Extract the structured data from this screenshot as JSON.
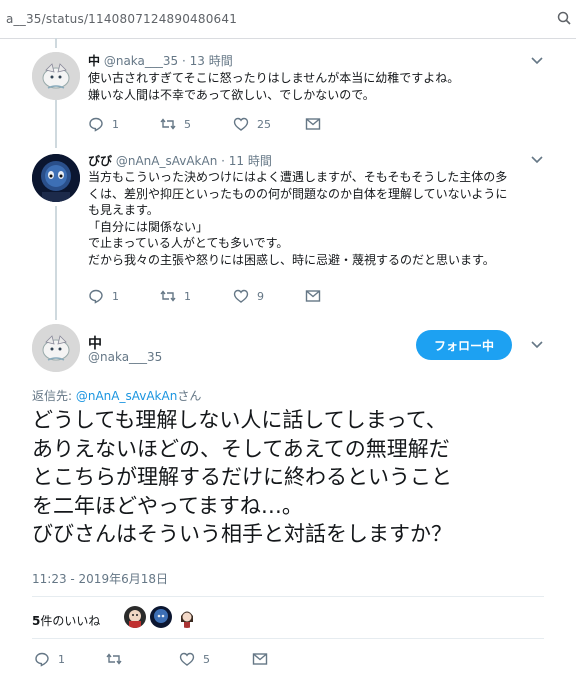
{
  "browser": {
    "url": "a__35/status/1140807124890480641",
    "zoom_icon": "zoom-icon"
  },
  "reply1": {
    "name": "中",
    "handle": "@naka___35",
    "time": "13 時間",
    "lines": [
      "使い古されすぎてそこに怒ったりはしませんが本当に幼稚ですよね。",
      "嫌いな人間は不幸であって欲しい、でしかないので。"
    ],
    "reply_count": "1",
    "retweet_count": "5",
    "like_count": "25"
  },
  "reply2": {
    "name": "びび",
    "handle": "@nAnA_sAvAkAn",
    "time": "11 時間",
    "lines": [
      "当方もこういった決めつけにはよく遭遇しますが、そもそもそうした主体の多",
      "くは、差別や抑圧といったものの何が問題なのか自体を理解していないように",
      "も見えます。",
      "「自分には関係ない」",
      "で止まっている人がとても多いです。",
      "だから我々の主張や怒りには困惑し、時に忌避・蔑視するのだと思います。"
    ],
    "reply_count": "1",
    "retweet_count": "1",
    "like_count": "9"
  },
  "main": {
    "name": "中",
    "handle": "@naka___35",
    "follow_label": "フォロー中",
    "reply_prefix": "返信先: ",
    "reply_mention": "@nAnA_sAvAkAn",
    "reply_suffix": "さん",
    "text_lines": [
      "どうしても理解しない人に話してしまって、",
      "ありえないほどの、そしてあえての無理解だ",
      "とこちらが理解するだけに終わるということ",
      "を二年ほどやってますね…。",
      "びびさんはそういう相手と対話をしますか？"
    ],
    "timestamp": "11:23 - 2019年6月18日",
    "likes_number": "5",
    "likes_label": "件のいいね",
    "reply_count": "1",
    "retweet_count": "",
    "like_count": "5"
  },
  "colors": {
    "accent": "#1da1f2",
    "muted": "#657786",
    "text": "#14171a",
    "link": "#1b95e0"
  }
}
